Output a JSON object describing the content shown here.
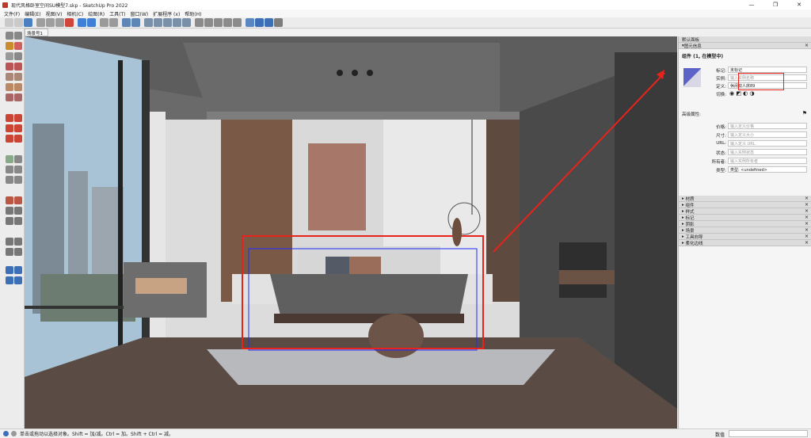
{
  "window": {
    "title": "现代风格卧室空间SU模型7.skp - SketchUp Pro 2022",
    "controls": [
      "—",
      "❐",
      "✕"
    ]
  },
  "menu": [
    "文件(F)",
    "编辑(E)",
    "视图(V)",
    "相机(C)",
    "绘图(R)",
    "工具(T)",
    "窗口(W)",
    "扩展程序 (x)",
    "帮助(H)"
  ],
  "scene_tab": "场景号1",
  "panel": {
    "title": "默认面板",
    "entity_info": {
      "section": "图元信息",
      "heading": "组件 (1, 在模型中)",
      "tag_label": "标记:",
      "tag_value": "未标记",
      "instance_label": "实例:",
      "instance_placeholder": "输入实例名称",
      "definition_label": "定义:",
      "definition_value": "休闲双人床89",
      "toggle_label": "切换:"
    },
    "dynamic": {
      "heading": "高级属性:",
      "rows": [
        {
          "label": "价格:",
          "placeholder": "输入定义价格"
        },
        {
          "label": "尺寸:",
          "placeholder": "输入定义大小"
        },
        {
          "label": "URL:",
          "placeholder": "输入定义 URL"
        },
        {
          "label": "状态:",
          "placeholder": "输入实例状态"
        },
        {
          "label": "所有者:",
          "placeholder": "输入实例所有者"
        }
      ],
      "type_label": "类型:",
      "type_value": "类型: <undefined>"
    },
    "trays": [
      "材质",
      "组件",
      "样式",
      "标记",
      "阴影",
      "场景",
      "工具向导",
      "柔化边线"
    ]
  },
  "status": {
    "message": "单击或拖动以选择对象。Shift = 加/减。Ctrl = 加。Shift + Ctrl = 减。",
    "measure_label": "数值"
  },
  "colors": {
    "accent_red": "#e8231b",
    "selection_blue": "#1f2cff"
  }
}
